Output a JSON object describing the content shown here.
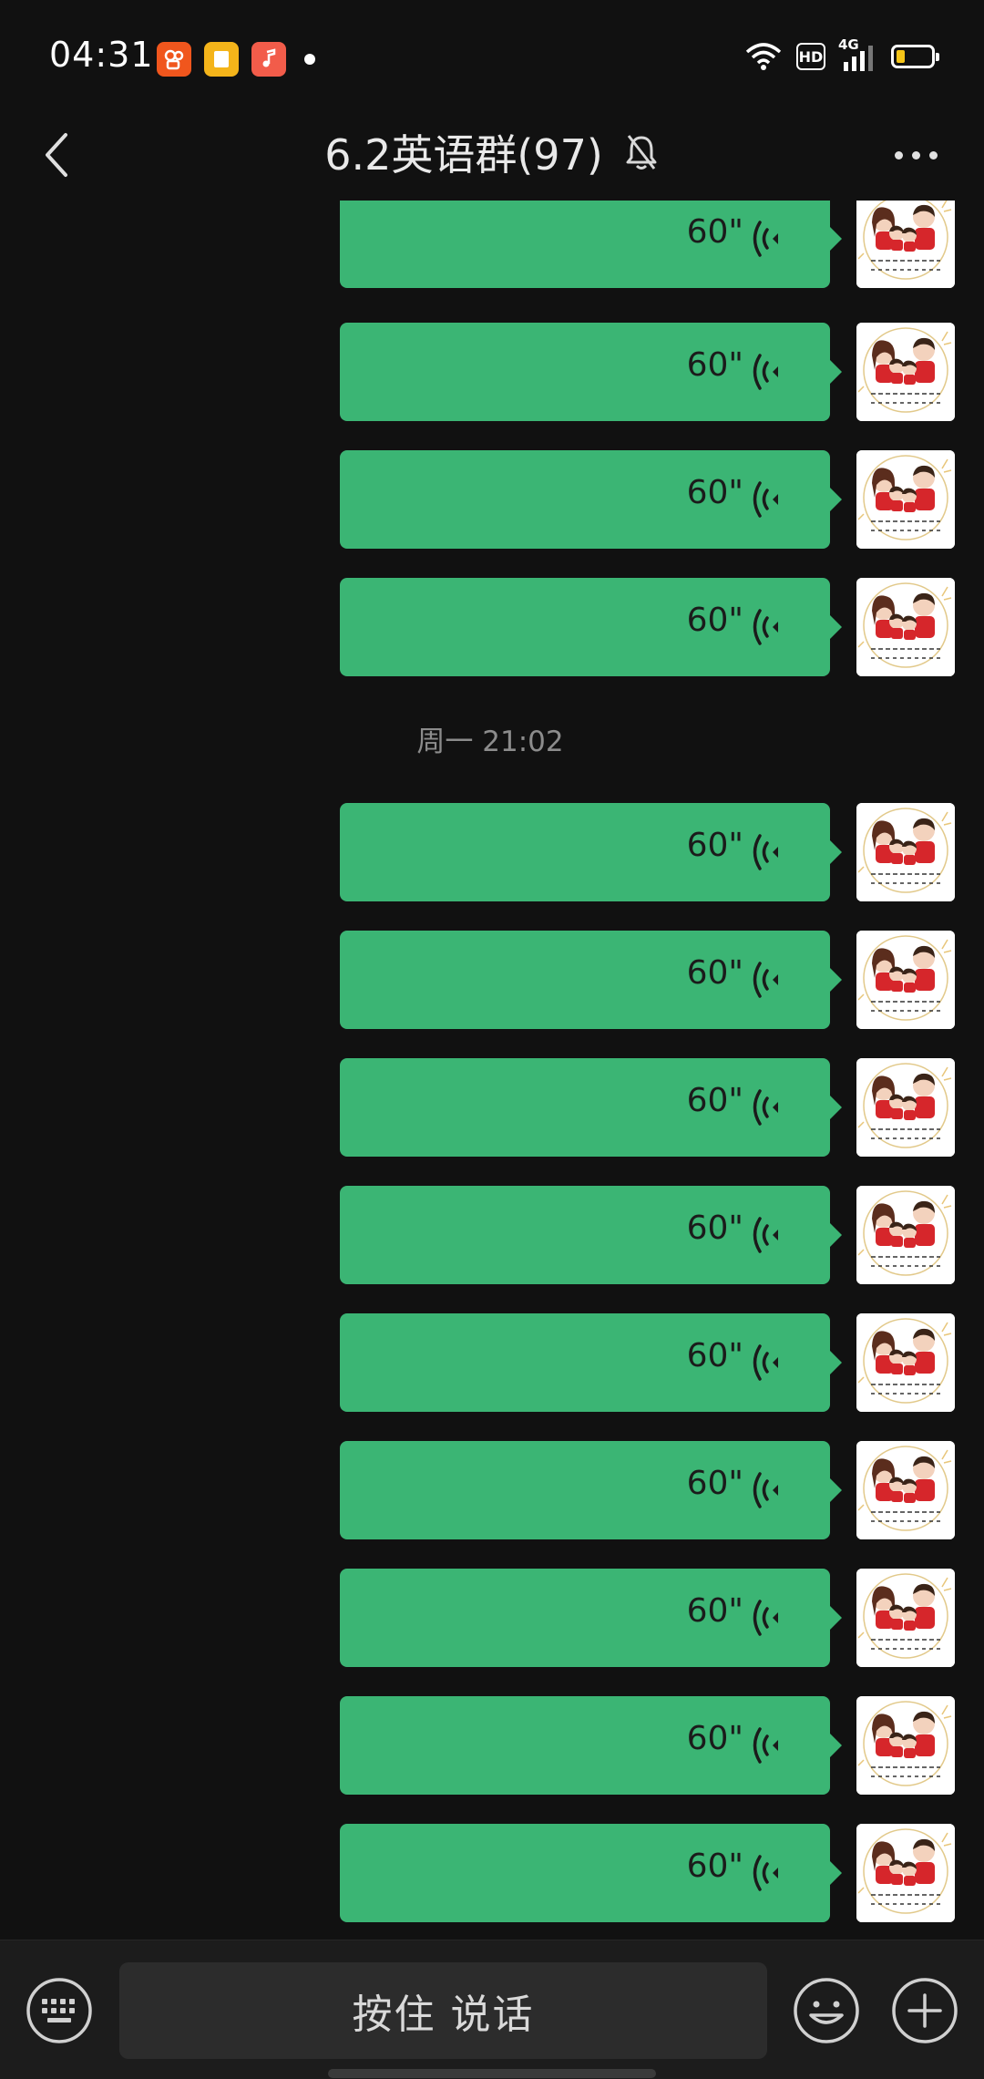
{
  "status_bar": {
    "time": "04:31",
    "network_label": "4G",
    "hd_label": "HD",
    "battery_level": 0.25,
    "apps": [
      {
        "icon": "kuaishou-app-icon",
        "color": "#f0561d"
      },
      {
        "icon": "notes-app-icon",
        "color": "#f4b41a"
      },
      {
        "icon": "music-app-icon",
        "color": "#f25c4a"
      }
    ]
  },
  "header": {
    "title": "6.2英语群(97)",
    "muted": true
  },
  "chat": {
    "timestamp": "周一 21:02",
    "messages_before": [
      {
        "duration": "60\""
      },
      {
        "duration": "60\""
      },
      {
        "duration": "60\""
      },
      {
        "duration": "60\""
      }
    ],
    "messages_after": [
      {
        "duration": "60\""
      },
      {
        "duration": "60\""
      },
      {
        "duration": "60\""
      },
      {
        "duration": "60\""
      },
      {
        "duration": "60\""
      },
      {
        "duration": "60\""
      },
      {
        "duration": "60\""
      },
      {
        "duration": "60\""
      },
      {
        "duration": "60\""
      }
    ]
  },
  "input_bar": {
    "hold_to_talk_label": "按住 说话"
  },
  "colors": {
    "bubble": "#3bb574",
    "background": "#111111",
    "input_bar": "#1c1c1c"
  }
}
